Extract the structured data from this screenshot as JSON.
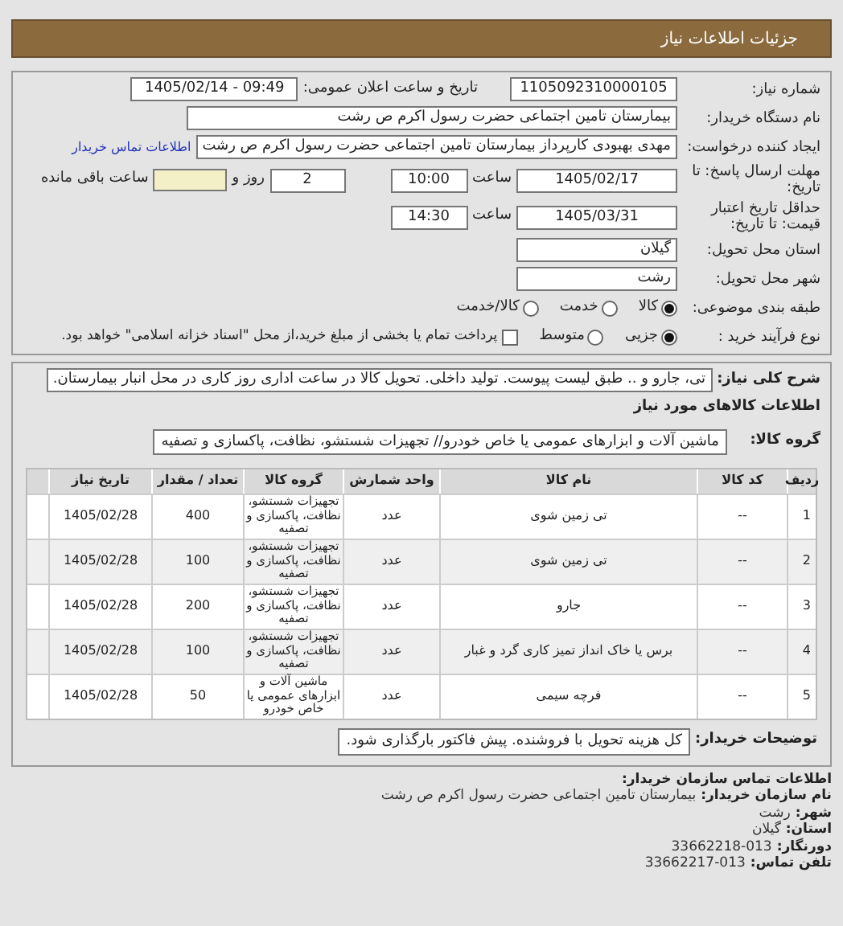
{
  "header": {
    "title": "جزئیات اطلاعات نیاز"
  },
  "need_number": {
    "label": "شماره نیاز:",
    "value": "1105092310000105"
  },
  "announce": {
    "label": "تاریخ و ساعت اعلان عمومی:",
    "value": "1405/02/14 - 09:49"
  },
  "buyer_org": {
    "label": "نام دستگاه خریدار:",
    "value": "بیمارستان  تامین اجتماعی حضرت رسول اکرم ص رشت"
  },
  "creator": {
    "label": "ایجاد کننده درخواست:",
    "value": "مهدی بهبودی کارپرداز بیمارستان  تامین اجتماعی حضرت رسول اکرم ص رشت",
    "link": "اطلاعات تماس خریدار"
  },
  "deadline": {
    "label": "مهلت ارسال پاسخ: تا تاریخ:",
    "date": "1405/02/17",
    "time_label": "ساعت",
    "time": "10:00",
    "days": "2",
    "days_label": "روز و",
    "remaining_label": "ساعت باقی مانده"
  },
  "validity": {
    "label": "حداقل تاریخ اعتبار قیمت: تا تاریخ:",
    "date": "1405/03/31",
    "time_label": "ساعت",
    "time": "14:30"
  },
  "province": {
    "label": "استان محل تحویل:",
    "value": "گیلان"
  },
  "city": {
    "label": "شهر محل تحویل:",
    "value": "رشت"
  },
  "category": {
    "label": "طبقه بندی موضوعی:",
    "options": [
      {
        "label": "کالا",
        "selected": true
      },
      {
        "label": "خدمت",
        "selected": false
      },
      {
        "label": "کالا/خدمت",
        "selected": false
      }
    ]
  },
  "process": {
    "label": "نوع فرآیند خرید :",
    "options": [
      {
        "label": "جزیی",
        "selected": true
      },
      {
        "label": "متوسط",
        "selected": false
      }
    ],
    "payment": {
      "checked": false,
      "text": "پرداخت تمام یا بخشی از مبلغ خرید،از محل \"اسناد خزانه اسلامی\" خواهد بود."
    }
  },
  "description": {
    "label": "شرح کلی نیاز:",
    "value": "تی، جارو و .. طبق لیست پیوست. تولید داخلی. تحویل کالا در ساعت اداری روز کاری در محل انبار بیمارستان."
  },
  "goods_title": "اطلاعات کالاهای مورد نیاز",
  "goods_group": {
    "label": "گروه کالا:",
    "value": "ماشین آلات و ابزارهای عمومی یا خاص خودرو// تجهیزات شستشو، نظافت، پاکسازی و تصفیه"
  },
  "table": {
    "columns": [
      "ردیف",
      "کد کالا",
      "نام کالا",
      "واحد شمارش",
      "گروه کالا",
      "تعداد / مقدار",
      "تاریخ نیاز"
    ],
    "rows": [
      [
        "1",
        "--",
        "تی زمین شوی",
        "عدد",
        "تجهیزات شستشو، نظافت، پاکسازی و تصفیه",
        "400",
        "1405/02/28"
      ],
      [
        "2",
        "--",
        "تی زمین شوی",
        "عدد",
        "تجهیزات شستشو، نظافت، پاکسازی و تصفیه",
        "100",
        "1405/02/28"
      ],
      [
        "3",
        "--",
        "جارو",
        "عدد",
        "تجهیزات شستشو، نظافت، پاکسازی و تصفیه",
        "200",
        "1405/02/28"
      ],
      [
        "4",
        "--",
        "برس یا خاک انداز تمیز کاری گرد و غبار",
        "عدد",
        "تجهیزات شستشو، نظافت، پاکسازی و تصفیه",
        "100",
        "1405/02/28"
      ],
      [
        "5",
        "--",
        "فرچه سیمی",
        "عدد",
        "ماشین آلات و ابزارهای عمومی یا خاص خودرو",
        "50",
        "1405/02/28"
      ]
    ]
  },
  "buyer_notes": {
    "label": "توضیحات خریدار:",
    "value": "کل هزینه تحویل با فروشنده. پیش فاکتور بارگذاری شود."
  },
  "contact": {
    "title": "اطلاعات تماس سازمان خریدار:",
    "fields": [
      {
        "label": "نام سازمان خریدار:",
        "value": "بیمارستان تامین اجتماعی حضرت رسول اکرم ص رشت"
      },
      {
        "label": "شهر:",
        "value": "رشت"
      },
      {
        "label": "استان:",
        "value": "گیلان"
      },
      {
        "label": "دورنگار:",
        "value": "33662218-013"
      },
      {
        "label": "تلفن تماس:",
        "value": "33662217-013"
      }
    ]
  }
}
